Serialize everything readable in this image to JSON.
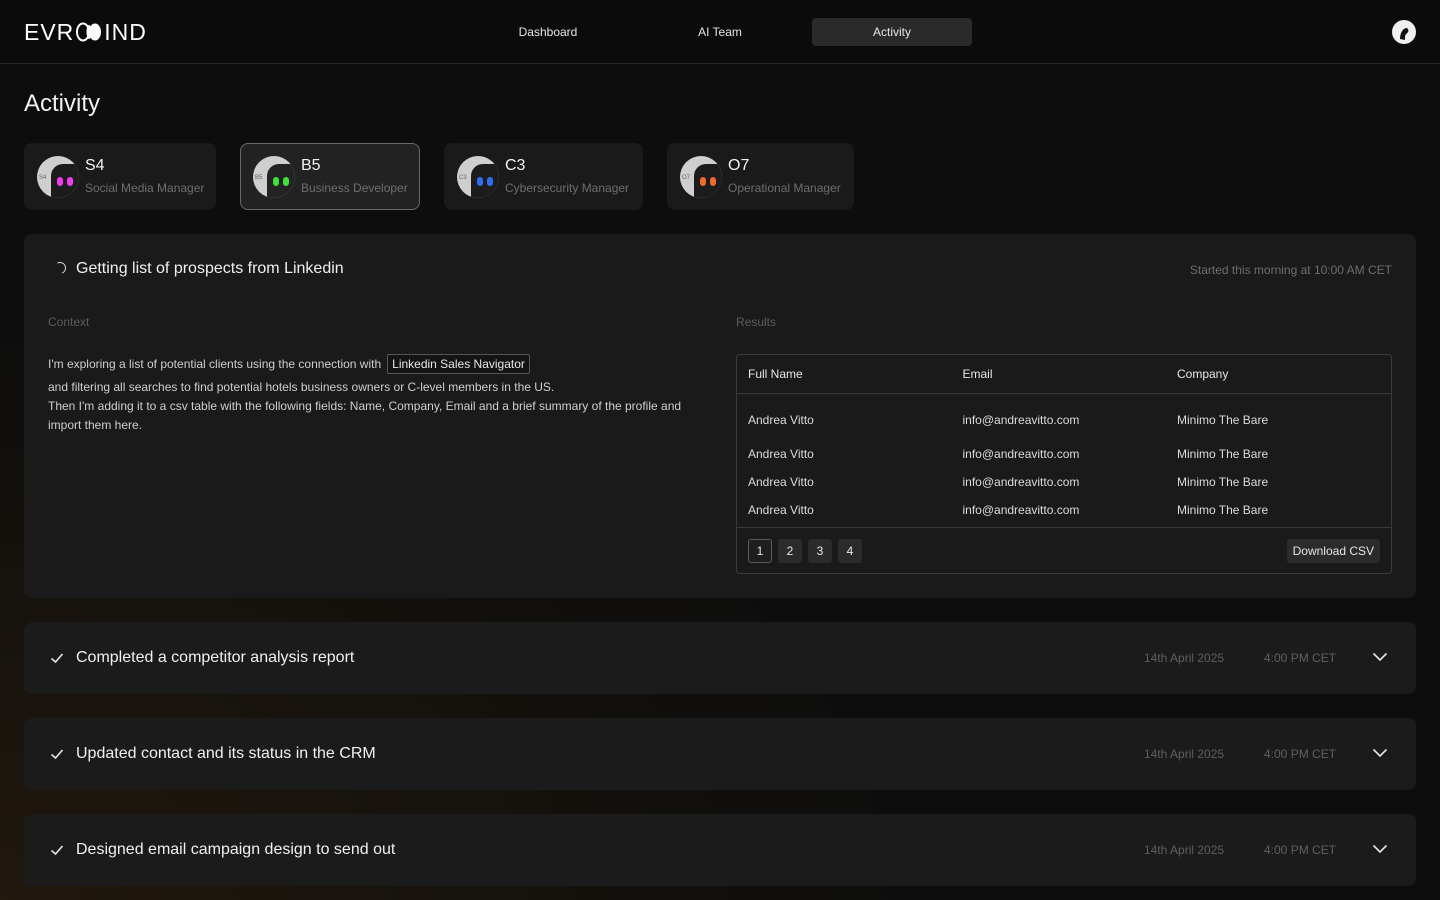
{
  "header": {
    "logo_text_left": "EVR",
    "logo_text_right": "IND",
    "nav": [
      {
        "label": "Dashboard",
        "active": false
      },
      {
        "label": "AI Team",
        "active": false
      },
      {
        "label": "Activity",
        "active": true
      }
    ],
    "avatar_icon": "user-avatar-icon"
  },
  "page": {
    "title": "Activity"
  },
  "agents": [
    {
      "code": "S4",
      "role": "Social Media Manager",
      "eye_color": "#ee3df0",
      "selected": false
    },
    {
      "code": "B5",
      "role": "Business Developer",
      "eye_color": "#3ee03a",
      "selected": true
    },
    {
      "code": "C3",
      "role": "Cybersecurity Manager",
      "eye_color": "#2f6df5",
      "selected": false
    },
    {
      "code": "O7",
      "role": "Operational Manager",
      "eye_color": "#f06a2a",
      "selected": false
    }
  ],
  "active_task": {
    "title": "Getting list of prospects from Linkedin",
    "started": "Started this morning at 10:00 AM CET",
    "context_label": "Context",
    "results_label": "Results",
    "context_intro": "I'm exploring a list of potential clients using the connection with",
    "context_tool": "Linkedin Sales Navigator",
    "context_line2": "and filtering all searches to find potential hotels business owners or C-level members in the US.",
    "context_line3": "Then I'm adding it to a csv table with the following fields: Name, Company, Email and a brief summary of the profile and import them here.",
    "table": {
      "columns": [
        "Full Name",
        "Email",
        "Company"
      ],
      "rows": [
        [
          "Andrea Vitto",
          "info@andreavitto.com",
          "Minimo The Bare"
        ],
        [
          "Andrea Vitto",
          "info@andreavitto.com",
          "Minimo The Bare"
        ],
        [
          "Andrea Vitto",
          "info@andreavitto.com",
          "Minimo The Bare"
        ],
        [
          "Andrea Vitto",
          "info@andreavitto.com",
          "Minimo The Bare"
        ]
      ],
      "pages": [
        "1",
        "2",
        "3",
        "4"
      ],
      "current_page": "1",
      "download_label": "Download CSV"
    }
  },
  "completed_tasks": [
    {
      "title": "Completed a competitor analysis report",
      "date": "14th April 2025",
      "time": "4:00 PM CET"
    },
    {
      "title": "Updated contact and its status in the CRM",
      "date": "14th April 2025",
      "time": "4:00 PM CET"
    },
    {
      "title": "Designed email campaign design to send out",
      "date": "14th April 2025",
      "time": "4:00 PM CET"
    }
  ]
}
